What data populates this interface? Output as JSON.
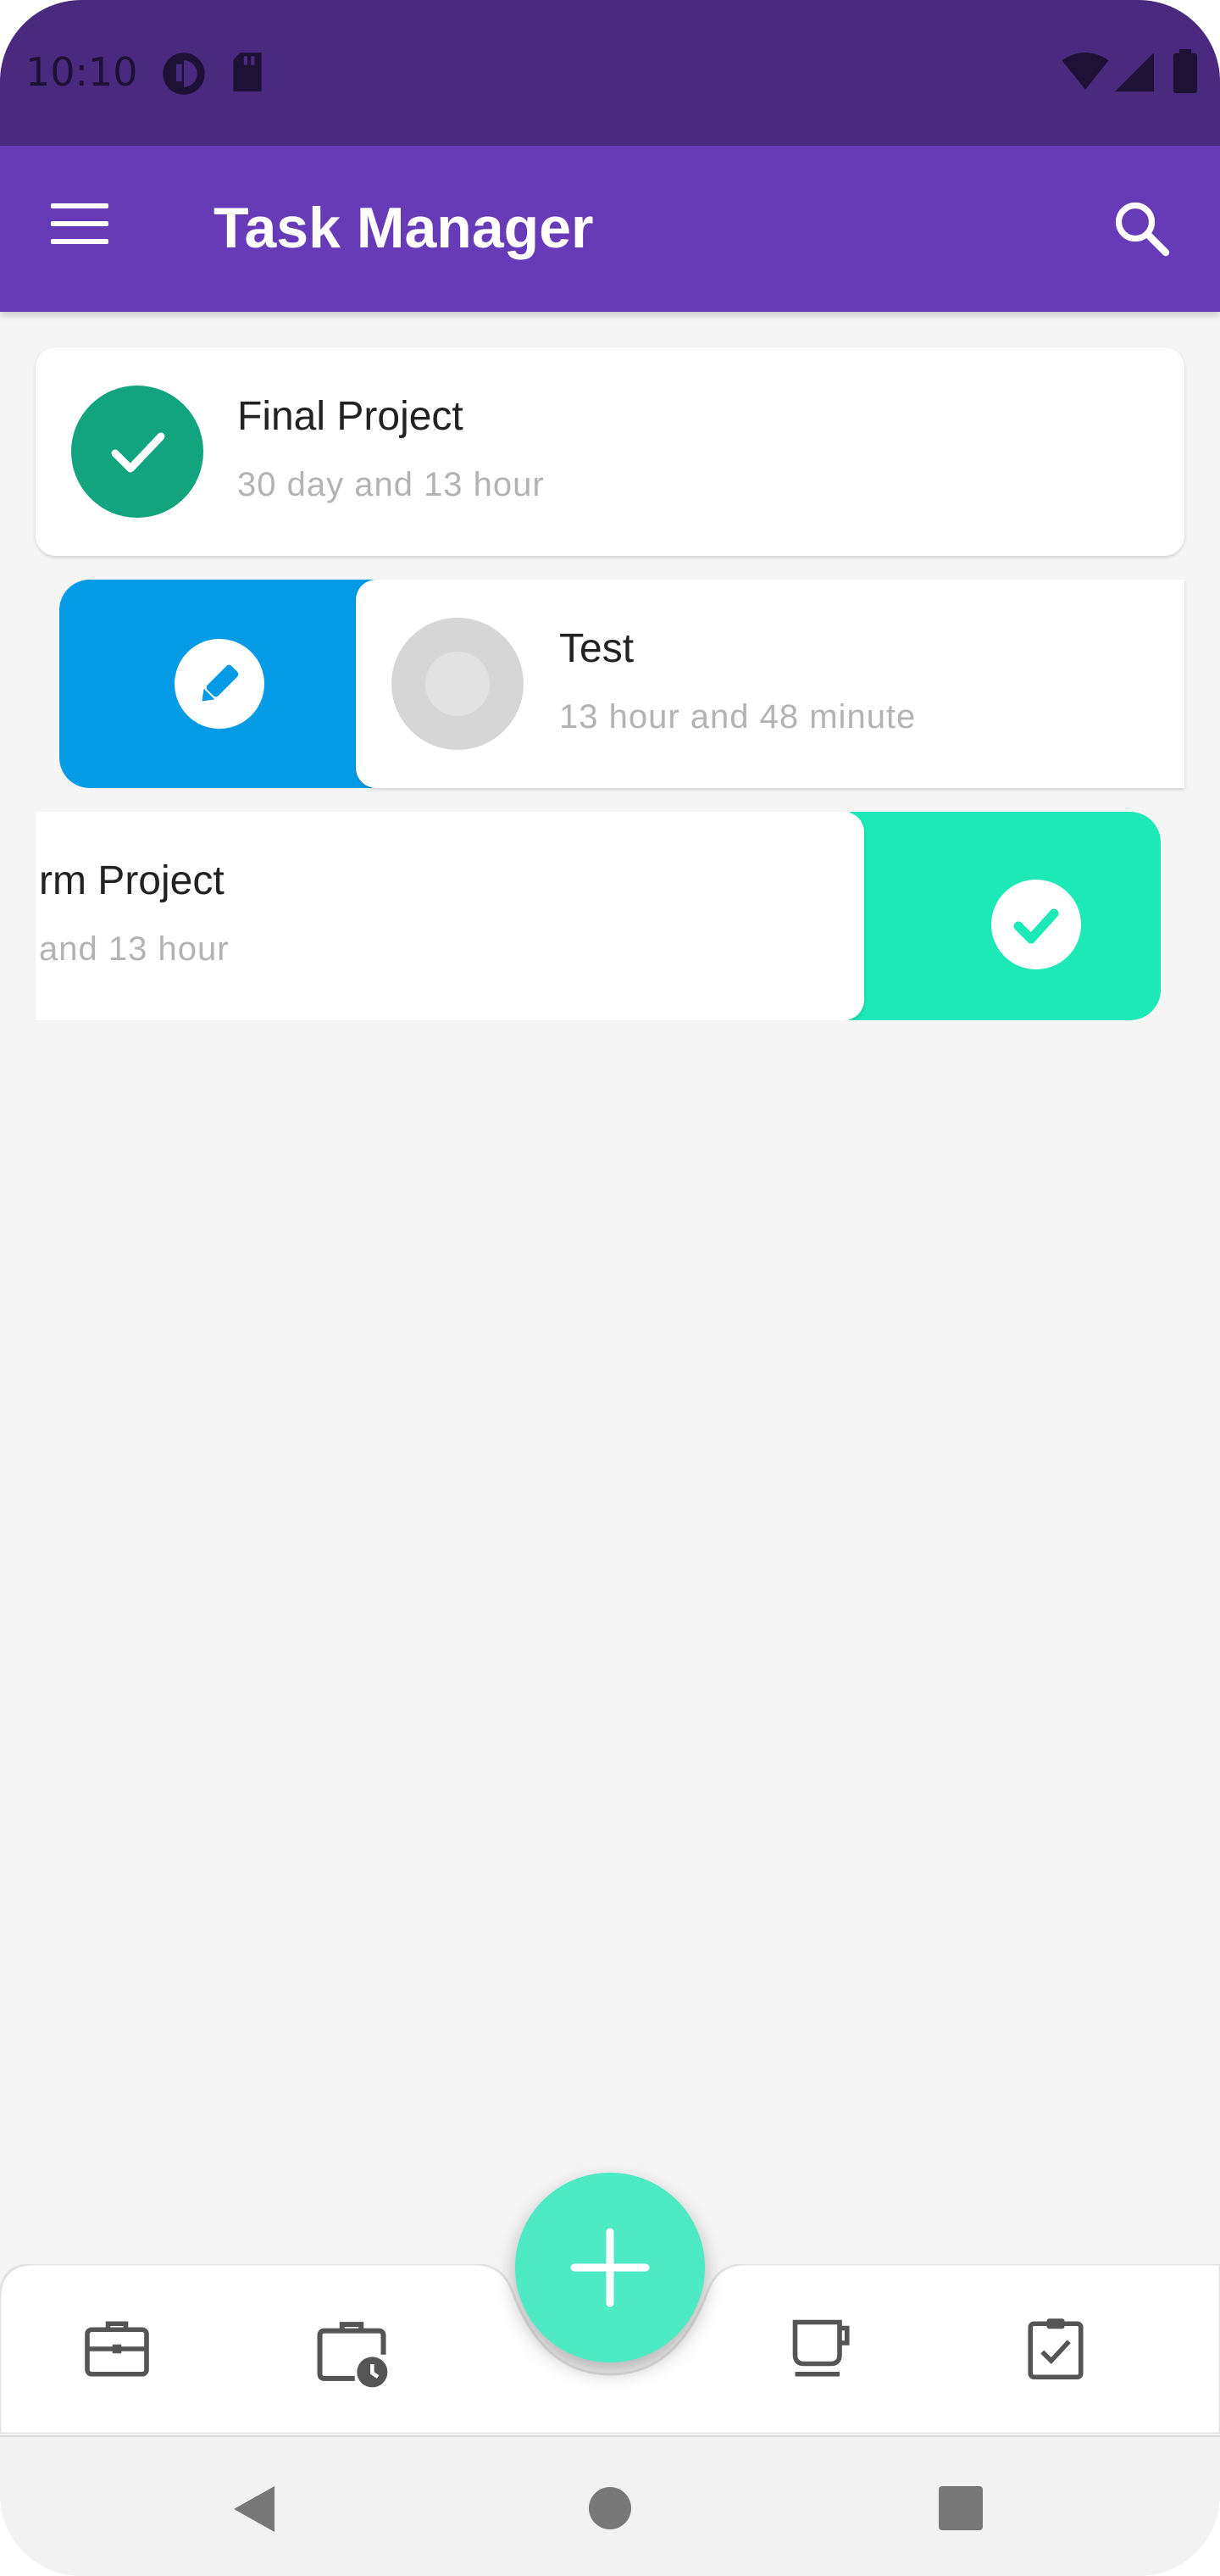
{
  "status_bar": {
    "time": "10:10",
    "icons_left": [
      "data-saver-icon",
      "sd-card-icon"
    ],
    "icons_right": [
      "wifi-icon",
      "cell-signal-icon",
      "battery-icon"
    ]
  },
  "app_bar": {
    "title": "Task Manager",
    "menu_icon": "hamburger-menu-icon",
    "search_icon": "search-icon"
  },
  "tasks": [
    {
      "title": "Final Project",
      "subtitle": "30 day and 13 hour",
      "status": "done",
      "color": "#12a37f"
    },
    {
      "title": "Test",
      "subtitle": "13 hour and 48 minute",
      "status": "pending",
      "swipe_action": "edit",
      "action_color": "#039be5"
    },
    {
      "title": "rm Project",
      "subtitle": "and 13 hour",
      "status": "pending",
      "swipe_action": "complete",
      "action_color": "#1de9b6"
    }
  ],
  "bottom_nav": {
    "items": [
      {
        "icon": "briefcase-icon"
      },
      {
        "icon": "briefcase-clock-icon"
      },
      {
        "icon": "coffee-cup-icon"
      },
      {
        "icon": "clipboard-check-icon"
      }
    ],
    "fab_icon": "plus-icon",
    "fab_color": "#4eeac3"
  },
  "system_nav": {
    "buttons": [
      "back-icon",
      "home-icon",
      "recents-icon"
    ]
  },
  "colors": {
    "primary": "#673ab7",
    "status_bar": "#4a2a7e",
    "background": "#f5f5f5"
  }
}
